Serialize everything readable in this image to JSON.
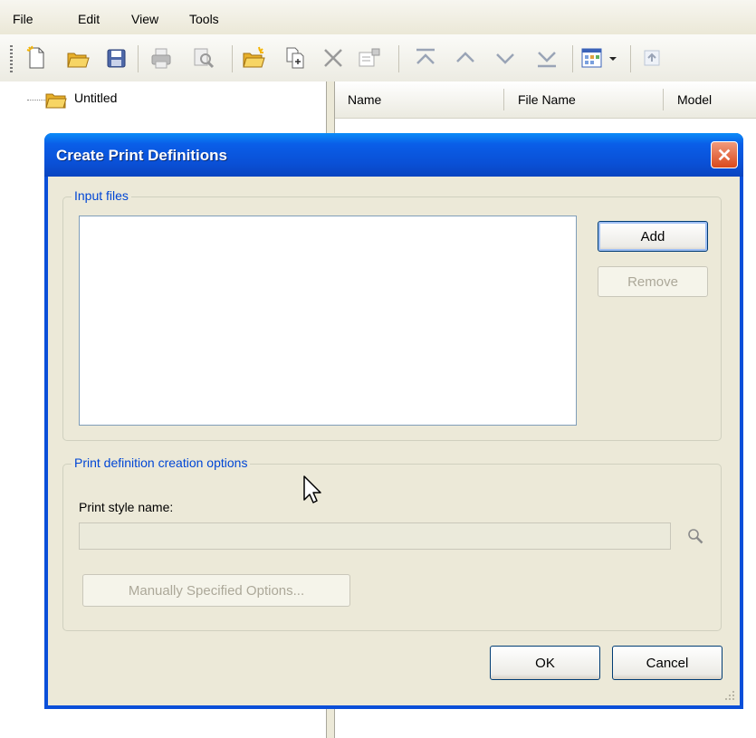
{
  "menu": {
    "items": [
      "File",
      "Edit",
      "View",
      "Tools"
    ]
  },
  "toolbar": {
    "icons": [
      "new-icon",
      "open-folder-icon",
      "save-icon",
      "print-icon",
      "print-preview-icon",
      "new-folder-icon",
      "copy-icon",
      "delete-icon",
      "properties-icon",
      "move-top-icon",
      "move-up-icon",
      "move-down-icon",
      "move-bottom-icon",
      "view-icon",
      "dropdown-arrow-icon",
      "help-icon"
    ]
  },
  "tree": {
    "root_label": "Untitled"
  },
  "list": {
    "columns": [
      "Name",
      "File Name",
      "Model"
    ]
  },
  "dialog": {
    "title": "Create Print Definitions",
    "input_files": {
      "label": "Input files",
      "add_label": "Add",
      "remove_label": "Remove",
      "items": []
    },
    "options": {
      "label": "Print definition creation options",
      "style_name_label": "Print style name:",
      "style_name_value": "",
      "manual_options_label": "Manually Specified Options..."
    },
    "ok_label": "OK",
    "cancel_label": "Cancel"
  },
  "colors": {
    "title_blue": "#0a50d6",
    "group_label_blue": "#0046d5",
    "close_red": "#d9491c",
    "face": "#ece9d8"
  }
}
